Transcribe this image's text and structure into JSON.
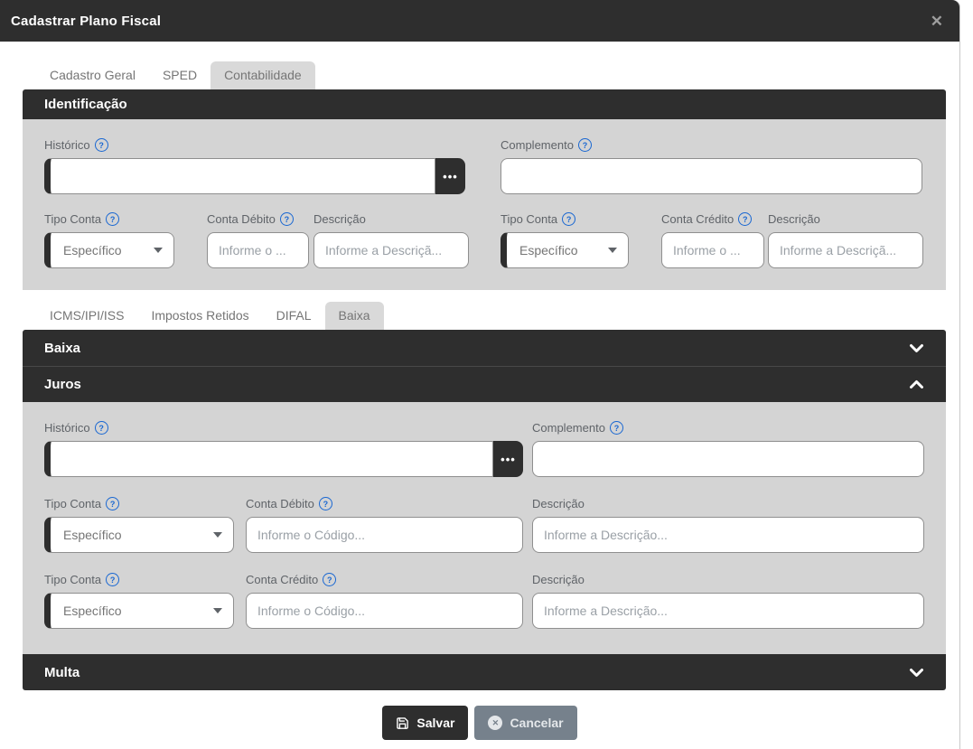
{
  "modal": {
    "title": "Cadastrar Plano Fiscal",
    "close_glyph": "✕"
  },
  "glyphs": {
    "help": "?",
    "more": "•••",
    "cancel_x": "✕"
  },
  "tabs_main": {
    "items": [
      {
        "label": "Cadastro Geral",
        "active": false
      },
      {
        "label": "SPED",
        "active": false
      },
      {
        "label": "Contabilidade",
        "active": true
      }
    ]
  },
  "identificacao": {
    "title": "Identificação",
    "historico": {
      "label": "Histórico",
      "value": ""
    },
    "complemento": {
      "label": "Complemento",
      "value": ""
    },
    "debito": {
      "tipo_label": "Tipo Conta",
      "tipo_value": "Específico",
      "conta_label": "Conta Débito",
      "conta_placeholder": "Informe o ...",
      "desc_label": "Descrição",
      "desc_placeholder": "Informe a Descriçã..."
    },
    "credito": {
      "tipo_label": "Tipo Conta",
      "tipo_value": "Específico",
      "conta_label": "Conta Crédito",
      "conta_placeholder": "Informe o ...",
      "desc_label": "Descrição",
      "desc_placeholder": "Informe a Descriçã..."
    }
  },
  "tabs_tax": {
    "items": [
      {
        "label": "ICMS/IPI/ISS",
        "active": false
      },
      {
        "label": "Impostos Retidos",
        "active": false
      },
      {
        "label": "DIFAL",
        "active": false
      },
      {
        "label": "Baixa",
        "active": true
      }
    ]
  },
  "accordion": {
    "baixa_title": "Baixa",
    "juros_title": "Juros",
    "multa_title": "Multa",
    "juros": {
      "historico": {
        "label": "Histórico",
        "value": ""
      },
      "complemento": {
        "label": "Complemento",
        "value": ""
      },
      "debito": {
        "tipo_label": "Tipo Conta",
        "tipo_value": "Específico",
        "conta_label": "Conta Débito",
        "conta_placeholder": "Informe o Código...",
        "desc_label": "Descrição",
        "desc_placeholder": "Informe a Descrição..."
      },
      "credito": {
        "tipo_label": "Tipo Conta",
        "tipo_value": "Específico",
        "conta_label": "Conta Crédito",
        "conta_placeholder": "Informe o Código...",
        "desc_label": "Descrição",
        "desc_placeholder": "Informe a Descrição..."
      }
    }
  },
  "footer": {
    "save_label": "Salvar",
    "cancel_label": "Cancelar"
  },
  "colors": {
    "header_bg": "#2e2e2e",
    "panel_bg": "#d4d4d4",
    "active_tab_bg": "#d9d9d9",
    "help_blue": "#1967d2",
    "cancel_bg": "#76818c"
  }
}
